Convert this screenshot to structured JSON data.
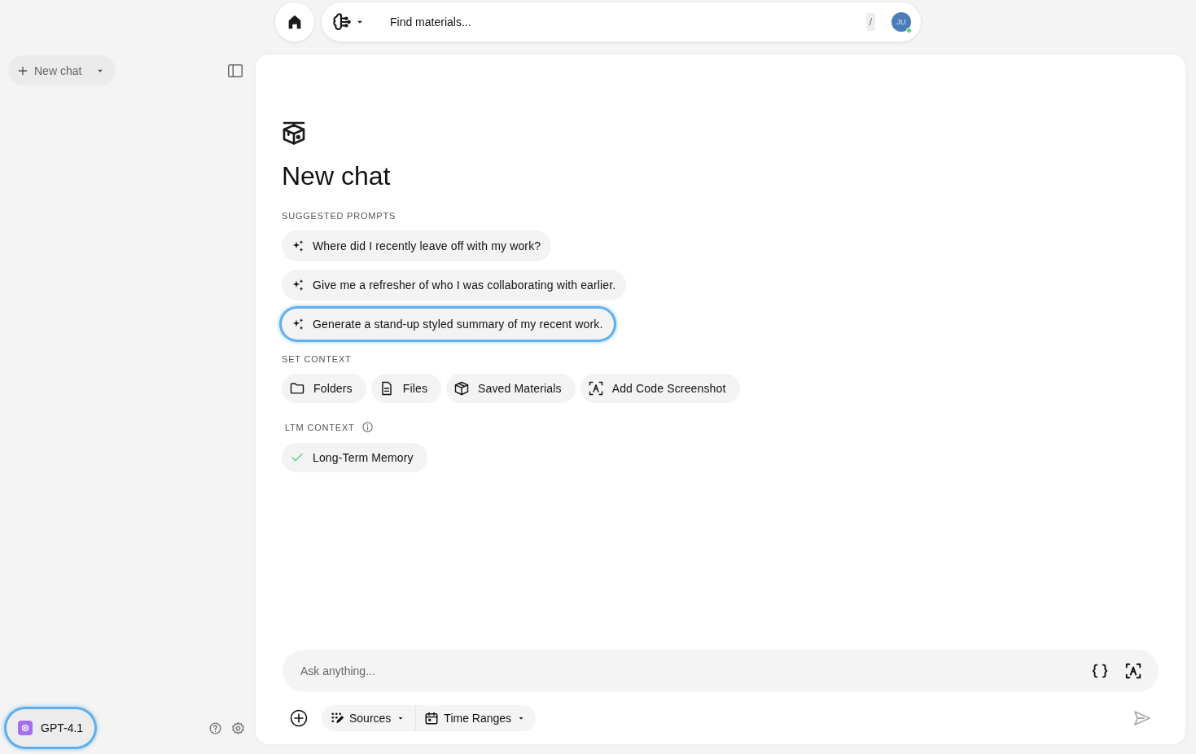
{
  "top_bar": {
    "search": {
      "placeholder": "Find materials..."
    },
    "shortcut_key": "/",
    "avatar": {
      "initials": "JU",
      "online": true
    }
  },
  "sidebar": {
    "new_chat_button": "New chat",
    "model": {
      "label": "GPT-4.1",
      "focused": true
    }
  },
  "main": {
    "title": "New chat",
    "suggested_prompts": {
      "heading": "SUGGESTED PROMPTS",
      "items": [
        {
          "text": "Where did I recently leave off with my work?",
          "focused": false
        },
        {
          "text": "Give me a refresher of who I was collaborating with earlier.",
          "focused": false
        },
        {
          "text": "Generate a stand-up styled summary of my recent work.",
          "focused": true
        }
      ]
    },
    "set_context": {
      "heading": "SET CONTEXT",
      "items": [
        {
          "kind": "folder",
          "label": "Folders"
        },
        {
          "kind": "file",
          "label": "Files"
        },
        {
          "kind": "materials",
          "label": "Saved Materials"
        },
        {
          "kind": "screenshot",
          "label": "Add Code Screenshot"
        }
      ]
    },
    "ltm_context": {
      "heading": "LTM CONTEXT",
      "items": [
        {
          "label": "Long-Term Memory",
          "checked": true
        }
      ]
    }
  },
  "composer": {
    "placeholder": "Ask anything...",
    "filters": [
      {
        "kind": "sources",
        "label": "Sources"
      },
      {
        "kind": "time",
        "label": "Time Ranges"
      }
    ]
  }
}
